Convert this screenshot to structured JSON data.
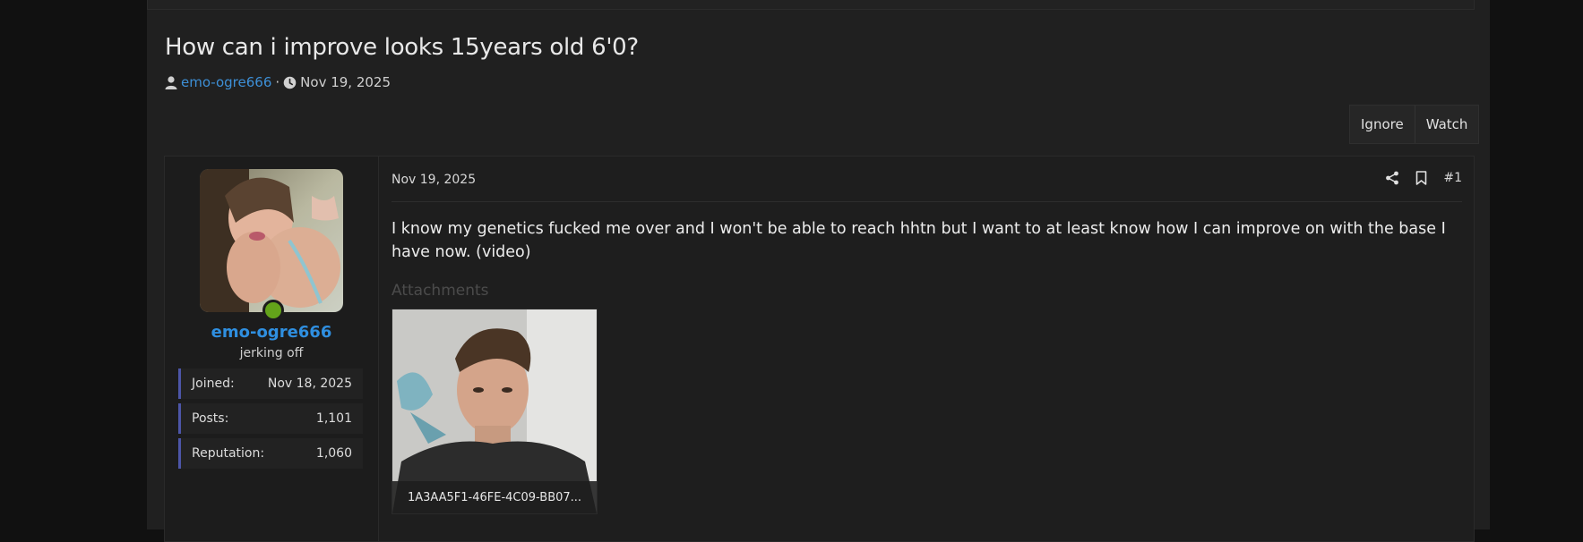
{
  "thread": {
    "title": "How can i improve looks 15years old 6'0?",
    "author": "emo-ogre666",
    "separator": "·",
    "date": "Nov 19, 2025"
  },
  "actions": {
    "ignore_label": "Ignore",
    "watch_label": "Watch"
  },
  "user": {
    "name": "emo-ogre666",
    "title": "jerking off",
    "stats": [
      {
        "label": "Joined:",
        "value": "Nov 18, 2025"
      },
      {
        "label": "Posts:",
        "value": "1,101"
      },
      {
        "label": "Reputation:",
        "value": "1,060"
      }
    ],
    "online_color": "#63a31a"
  },
  "post": {
    "date": "Nov 19, 2025",
    "number": "#1",
    "body": "I know my genetics fucked me over and I won't be able to reach hhtn but I want to at least know how I can improve on with the base I have now. (video)",
    "attachments_heading": "Attachments",
    "attachment_name": "1A3AA5F1-46FE-4C09-BB07...",
    "icons": [
      "share-icon",
      "bookmark-icon"
    ]
  },
  "colors": {
    "link": "#3d8fd6",
    "username": "#2f8fe0",
    "stat_accent": "#4d56a8",
    "background": "#202020"
  }
}
